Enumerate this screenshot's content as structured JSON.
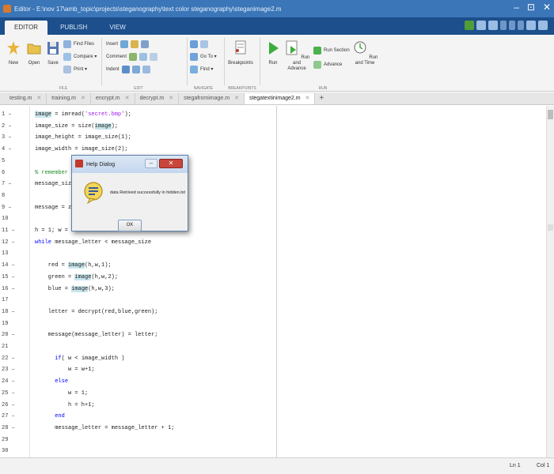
{
  "window": {
    "title": "Editor - E:\\nov 17\\amb_topic\\projects\\steganography\\text color steganography\\steganimage2.m",
    "controls": [
      "–",
      "⊡",
      "✕"
    ]
  },
  "ribbon_tabs": [
    "EDITOR",
    "PUBLISH",
    "VIEW"
  ],
  "ribbon": {
    "file": {
      "new": "New",
      "open": "Open",
      "save": "Save",
      "find_files": "Find Files",
      "compare": "Compare ▾",
      "print": "Print ▾",
      "section": "FILE"
    },
    "edit": {
      "insert": "Insert",
      "comment": "Comment",
      "indent": "Indent",
      "section": "EDIT"
    },
    "navigate": {
      "goto": "Go To ▾",
      "find": "Find ▾",
      "section": "NAVIGATE"
    },
    "breakpoints": {
      "label": "Breakpoints",
      "section": "BREAKPOINTS"
    },
    "run": {
      "run": "Run",
      "run_and_advance": "Run and Advance",
      "run_section": "Run Section",
      "advance": "Advance",
      "run_and_time": "Run and Time",
      "section": "RUN"
    }
  },
  "file_tabs": [
    {
      "name": "testing.m",
      "active": false
    },
    {
      "name": "training.m",
      "active": false
    },
    {
      "name": "encrypt.m",
      "active": false
    },
    {
      "name": "decrypt.m",
      "active": false
    },
    {
      "name": "stegafromimage.m",
      "active": false
    },
    {
      "name": "stegatextinimage2.m",
      "active": true
    }
  ],
  "file_tab_close": "✕",
  "add_tab": "+",
  "code_lines": [
    {
      "n": "1 –",
      "text": "image = imread('secret.bmp');"
    },
    {
      "n": "2 –",
      "text": "image_size = size(image);"
    },
    {
      "n": "3 –",
      "text": "image_height = image_size(1);"
    },
    {
      "n": "4 –",
      "text": "image_width = image_size(2);"
    },
    {
      "n": "5",
      "text": ""
    },
    {
      "n": "6",
      "text": "% remember                          lue pixel"
    },
    {
      "n": "7 –",
      "text": "message_size                         ;"
    },
    {
      "n": "8",
      "text": ""
    },
    {
      "n": "9 –",
      "text": "message = ze"
    },
    {
      "n": "10",
      "text": ""
    },
    {
      "n": "11 –",
      "text": "h = 1; w = 1"
    },
    {
      "n": "12 –",
      "text": "while message_letter < message_size"
    },
    {
      "n": "13",
      "text": ""
    },
    {
      "n": "14 –",
      "text": "    red = image(h,w,1);"
    },
    {
      "n": "15 –",
      "text": "    green = image(h,w,2);"
    },
    {
      "n": "16 –",
      "text": "    blue = image(h,w,3);"
    },
    {
      "n": "17",
      "text": ""
    },
    {
      "n": "18 –",
      "text": "    letter = decrypt(red,blue,green);"
    },
    {
      "n": "19",
      "text": ""
    },
    {
      "n": "20 –",
      "text": "    message(message_letter) = letter;"
    },
    {
      "n": "21",
      "text": ""
    },
    {
      "n": "22 –",
      "text": "      if( w < image_width )"
    },
    {
      "n": "23 –",
      "text": "          w = w+1;"
    },
    {
      "n": "24 –",
      "text": "      else"
    },
    {
      "n": "25 –",
      "text": "          w = 1;"
    },
    {
      "n": "26 –",
      "text": "          h = h+1;"
    },
    {
      "n": "27 –",
      "text": "      end"
    },
    {
      "n": "28 –",
      "text": "      message_letter = message_letter + 1;"
    },
    {
      "n": "29",
      "text": ""
    },
    {
      "n": "30",
      "text": ""
    }
  ],
  "status": {
    "line": "Ln 1",
    "col": "Col 1"
  },
  "dialog": {
    "title": "Help Dialog",
    "message": "data Retrived successfully in hidden.txt",
    "ok": "OK"
  },
  "colors": {
    "title_bar": "#3a76b8",
    "tab_strip": "#1c4f8c",
    "highlight": "#c8e6ec",
    "comment": "#228b22",
    "string": "#a020f0",
    "keyword": "#0000ff"
  },
  "icons": [
    "new-file-icon",
    "open-folder-icon",
    "save-icon",
    "breakpoints-icon",
    "run-icon",
    "run-advance-icon",
    "run-time-icon",
    "help-dialog-icon"
  ]
}
